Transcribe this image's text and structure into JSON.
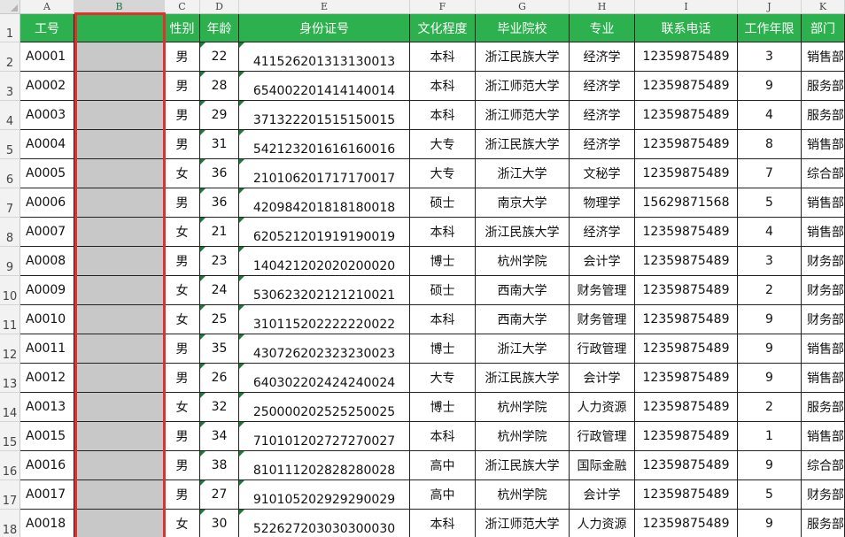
{
  "columns": [
    "A",
    "B",
    "C",
    "D",
    "E",
    "F",
    "G",
    "H",
    "I",
    "J",
    "K"
  ],
  "active_column": "B",
  "row_numbers": [
    "1",
    "2",
    "3",
    "4",
    "5",
    "6",
    "7",
    "8",
    "9",
    "10",
    "11",
    "12",
    "13",
    "14",
    "15",
    "16",
    "17",
    "18"
  ],
  "headers": {
    "id": "工号",
    "name": "",
    "gender": "性别",
    "age": "年龄",
    "id_card": "身份证号",
    "education": "文化程度",
    "school": "毕业院校",
    "major": "专业",
    "phone": "联系电话",
    "years": "工作年限",
    "dept": "部门"
  },
  "rows": [
    {
      "id": "A0001",
      "gender": "男",
      "age": "22",
      "id_card": "411526201313130013",
      "education": "本科",
      "school": "浙江民族大学",
      "major": "经济学",
      "phone": "12359875489",
      "years": "3",
      "dept": "销售部"
    },
    {
      "id": "A0002",
      "gender": "男",
      "age": "28",
      "id_card": "654002201414140014",
      "education": "本科",
      "school": "浙江师范大学",
      "major": "经济学",
      "phone": "12359875489",
      "years": "9",
      "dept": "服务部"
    },
    {
      "id": "A0003",
      "gender": "男",
      "age": "29",
      "id_card": "371322201515150015",
      "education": "本科",
      "school": "浙江师范大学",
      "major": "经济学",
      "phone": "12359875489",
      "years": "4",
      "dept": "服务部"
    },
    {
      "id": "A0004",
      "gender": "男",
      "age": "31",
      "id_card": "542123201616160016",
      "education": "大专",
      "school": "浙江民族大学",
      "major": "经济学",
      "phone": "12359875489",
      "years": "8",
      "dept": "销售部"
    },
    {
      "id": "A0005",
      "gender": "女",
      "age": "36",
      "id_card": "210106201717170017",
      "education": "大专",
      "school": "浙江大学",
      "major": "文秘学",
      "phone": "12359875489",
      "years": "7",
      "dept": "综合部"
    },
    {
      "id": "A0006",
      "gender": "男",
      "age": "36",
      "id_card": "420984201818180018",
      "education": "硕士",
      "school": "南京大学",
      "major": "物理学",
      "phone": "15629871568",
      "years": "5",
      "dept": "销售部"
    },
    {
      "id": "A0007",
      "gender": "女",
      "age": "21",
      "id_card": "620521201919190019",
      "education": "本科",
      "school": "浙江民族大学",
      "major": "经济学",
      "phone": "12359875489",
      "years": "4",
      "dept": "销售部"
    },
    {
      "id": "A0008",
      "gender": "男",
      "age": "23",
      "id_card": "140421202020200020",
      "education": "博士",
      "school": "杭州学院",
      "major": "会计学",
      "phone": "12359875489",
      "years": "3",
      "dept": "财务部"
    },
    {
      "id": "A0009",
      "gender": "女",
      "age": "24",
      "id_card": "530623202121210021",
      "education": "硕士",
      "school": "西南大学",
      "major": "财务管理",
      "phone": "12359875489",
      "years": "2",
      "dept": "财务部"
    },
    {
      "id": "A0010",
      "gender": "女",
      "age": "25",
      "id_card": "310115202222220022",
      "education": "本科",
      "school": "西南大学",
      "major": "财务管理",
      "phone": "12359875489",
      "years": "9",
      "dept": "财务部"
    },
    {
      "id": "A0011",
      "gender": "男",
      "age": "35",
      "id_card": "430726202323230023",
      "education": "博士",
      "school": "浙江大学",
      "major": "行政管理",
      "phone": "12359875489",
      "years": "9",
      "dept": "销售部"
    },
    {
      "id": "A0012",
      "gender": "男",
      "age": "26",
      "id_card": "640302202424240024",
      "education": "大专",
      "school": "浙江民族大学",
      "major": "会计学",
      "phone": "12359875489",
      "years": "9",
      "dept": "销售部"
    },
    {
      "id": "A0013",
      "gender": "女",
      "age": "32",
      "id_card": "250000202525250025",
      "education": "博士",
      "school": "杭州学院",
      "major": "人力资源",
      "phone": "12359875489",
      "years": "2",
      "dept": "服务部"
    },
    {
      "id": "A0015",
      "gender": "男",
      "age": "34",
      "id_card": "710101202727270027",
      "education": "本科",
      "school": "杭州学院",
      "major": "行政管理",
      "phone": "12359875489",
      "years": "1",
      "dept": "销售部"
    },
    {
      "id": "A0016",
      "gender": "男",
      "age": "38",
      "id_card": "810111202828280028",
      "education": "高中",
      "school": "浙江民族大学",
      "major": "国际金融",
      "phone": "12359875489",
      "years": "9",
      "dept": "综合部"
    },
    {
      "id": "A0017",
      "gender": "男",
      "age": "27",
      "id_card": "910105202929290029",
      "education": "高中",
      "school": "杭州学院",
      "major": "会计学",
      "phone": "12359875489",
      "years": "5",
      "dept": "财务部"
    },
    {
      "id": "A0018",
      "gender": "女",
      "age": "30",
      "id_card": "522627203030300030",
      "education": "本科",
      "school": "浙江师范大学",
      "major": "人力资源",
      "phone": "12359875489",
      "years": "9",
      "dept": "服务部"
    }
  ],
  "colors": {
    "header_fill": "#2db14f",
    "selected_fill": "#c8c8c8",
    "selection_border": "#e03030"
  }
}
